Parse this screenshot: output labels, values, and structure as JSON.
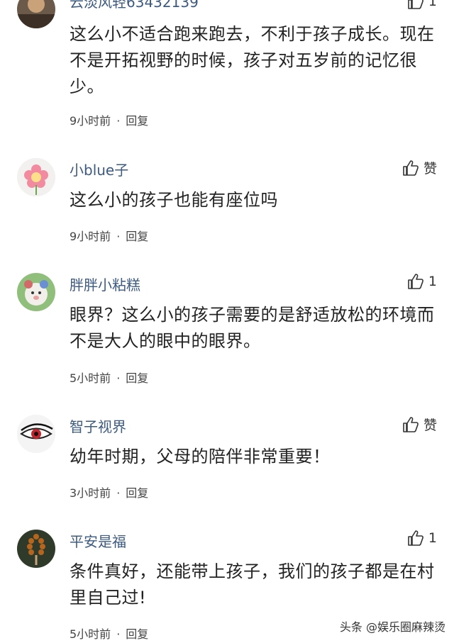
{
  "comments": [
    {
      "username": "云淡风轻63432139",
      "likes": "1",
      "text": "这么小不适合跑来跑去，不利于孩子成长。现在不是开拓视野的时候，孩子对五岁前的记忆很少。",
      "time": "9小时前",
      "reply": "回复"
    },
    {
      "username": "小blue子",
      "likes": "赞",
      "text": "这么小的孩子也能有座位吗",
      "time": "9小时前",
      "reply": "回复"
    },
    {
      "username": "胖胖小粘糕",
      "likes": "1",
      "text": "眼界？这么小的孩子需要的是舒适放松的环境而不是大人的眼中的眼界。",
      "time": "5小时前",
      "reply": "回复"
    },
    {
      "username": "智子视界",
      "likes": "赞",
      "text": "幼年时期，父母的陪伴非常重要！",
      "time": "3小时前",
      "reply": "回复"
    },
    {
      "username": "平安是福",
      "likes": "1",
      "text": "条件真好，还能带上孩子，我们的孩子都是在村里自己过!",
      "time": "5小时前",
      "reply": "回复"
    }
  ],
  "separator_dot": "·",
  "watermark": "头条 @娱乐圈麻辣烫",
  "icons": {
    "like": "thumbs-up-icon"
  },
  "colors": {
    "username": "#3d5a80",
    "text": "#222222"
  }
}
